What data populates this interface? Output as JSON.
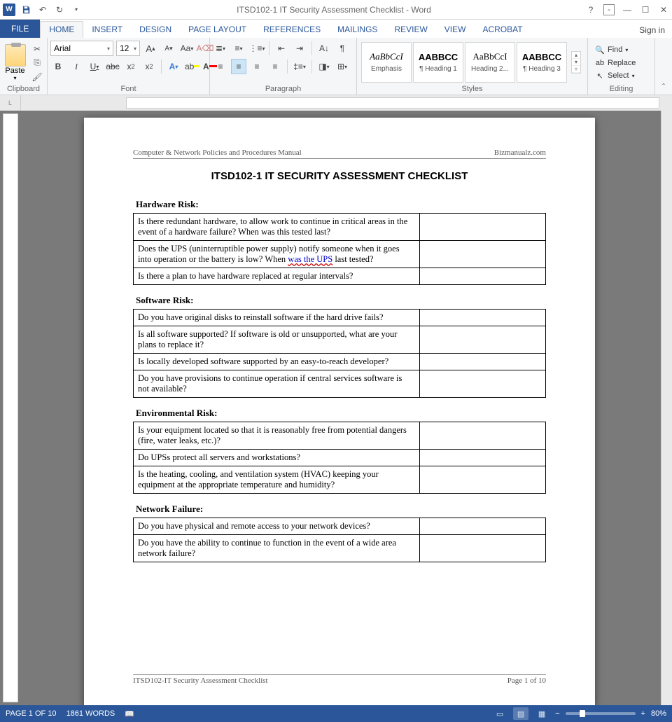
{
  "titlebar": {
    "title": "ITSD102-1 IT Security Assessment Checklist - Word",
    "signin": "Sign in"
  },
  "tabs": {
    "file": "FILE",
    "home": "HOME",
    "insert": "INSERT",
    "design": "DESIGN",
    "pagelayout": "PAGE LAYOUT",
    "references": "REFERENCES",
    "mailings": "MAILINGS",
    "review": "REVIEW",
    "view": "VIEW",
    "acrobat": "ACROBAT"
  },
  "ribbon": {
    "clipboard": {
      "paste": "Paste",
      "label": "Clipboard"
    },
    "font": {
      "name": "Arial",
      "size": "12",
      "label": "Font"
    },
    "paragraph": {
      "label": "Paragraph"
    },
    "styles": {
      "label": "Styles",
      "items": [
        {
          "preview": "AaBbCcI",
          "name": "Emphasis",
          "style": "font-style:italic;font-family:serif;"
        },
        {
          "preview": "AABBCC",
          "name": "¶ Heading 1",
          "style": "font-weight:bold;font-family:Arial;"
        },
        {
          "preview": "AaBbCcI",
          "name": "Heading 2...",
          "style": "font-family:serif;"
        },
        {
          "preview": "AABBCC",
          "name": "¶ Heading 3",
          "style": "font-weight:bold;font-family:Arial;"
        }
      ]
    },
    "editing": {
      "find": "Find",
      "replace": "Replace",
      "select": "Select",
      "label": "Editing"
    }
  },
  "document": {
    "header_left": "Computer & Network Policies and Procedures Manual",
    "header_right": "Bizmanualz.com",
    "title": "ITSD102-1   IT SECURITY ASSESSMENT CHECKLIST",
    "sections": [
      {
        "heading": "Hardware Risk:",
        "rows": [
          "Is there redundant hardware, to allow work to continue in critical areas in the event of a hardware failure?  When was this tested last?",
          "Does the UPS (uninterruptible power supply) notify someone when it goes into operation or the battery is low? When <a class='sq'>was the UPS</a> last tested?",
          "Is there a plan to have hardware replaced at regular intervals?"
        ]
      },
      {
        "heading": "Software Risk:",
        "rows": [
          "Do you have original disks to reinstall software if the hard drive fails?",
          "Is all software supported?  If software is old or unsupported, what are your plans to replace it?",
          "Is locally developed software supported by an easy-to-reach developer?",
          "Do you have provisions to continue operation if central services software is not available?"
        ]
      },
      {
        "heading": "Environmental Risk:",
        "rows": [
          "Is your equipment located so that it is reasonably free from potential dangers (fire, water leaks, etc.)?",
          "Do UPSs protect all servers and workstations?",
          "Is the heating, cooling, and ventilation system (HVAC) keeping your equipment at the appropriate temperature and humidity?"
        ]
      },
      {
        "heading": "Network Failure:",
        "rows": [
          "Do you have physical and remote access to your network devices?",
          "Do you have the ability to continue to function in the event of a wide area network failure?"
        ]
      }
    ],
    "footer_left": "ITSD102-IT Security Assessment Checklist",
    "footer_right": "Page 1 of 10"
  },
  "status": {
    "page": "PAGE 1 OF 10",
    "words": "1861 WORDS",
    "zoom": "80%"
  }
}
